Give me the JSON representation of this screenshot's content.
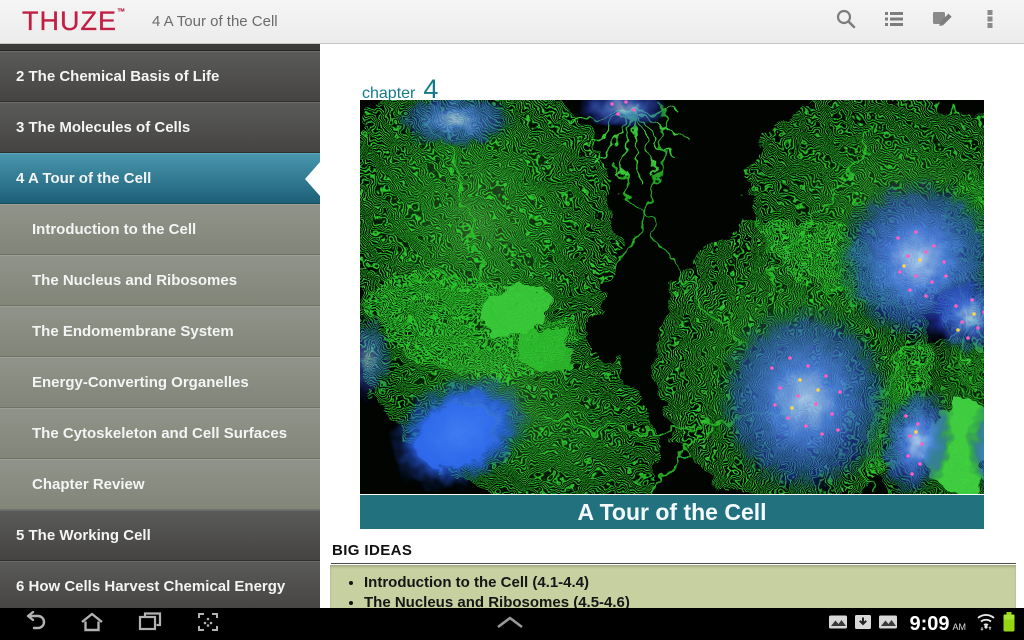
{
  "app_bar": {
    "logo": "THUZE",
    "logo_tm": "™",
    "title": "4 A Tour of the Cell",
    "actions": [
      "search",
      "table-of-contents",
      "notes",
      "more-options"
    ]
  },
  "sidebar": {
    "rows": [
      {
        "type": "chapter",
        "label": "2 The Chemical Basis of Life"
      },
      {
        "type": "chapter",
        "label": "3 The Molecules of Cells"
      },
      {
        "type": "chapter-selected",
        "label": "4 A Tour of the Cell"
      },
      {
        "type": "section",
        "label": "Introduction to the Cell"
      },
      {
        "type": "section",
        "label": "The Nucleus and Ribosomes"
      },
      {
        "type": "section",
        "label": "The Endomembrane System"
      },
      {
        "type": "section",
        "label": "Energy-Converting Organelles"
      },
      {
        "type": "section",
        "label": "The Cytoskeleton and Cell Surfaces"
      },
      {
        "type": "section",
        "label": "Chapter Review"
      },
      {
        "type": "chapter",
        "label": "5 The Working Cell"
      },
      {
        "type": "chapter",
        "label": "6 How Cells Harvest Chemical Energy"
      }
    ]
  },
  "content": {
    "chapter_label": "chapter",
    "chapter_number": "4",
    "figure_description": "fluorescence-micrograph-of-dividing-cells",
    "banner_title": "A Tour of the Cell",
    "big_ideas_heading": "BIG IDEAS",
    "big_ideas": [
      "Introduction to the Cell (4.1-4.4)",
      "The Nucleus and Ribosomes (4.5-4.6)"
    ]
  },
  "nav_bar": {
    "left_buttons": [
      "back",
      "home",
      "recent-apps",
      "screenshot"
    ],
    "center": "expand-handle",
    "notification_icons": [
      "gallery",
      "download",
      "gallery"
    ],
    "status_icons": [
      "wifi",
      "battery"
    ]
  },
  "status_bar": {
    "time": "9:09",
    "meridiem": "AM"
  },
  "colors": {
    "accent_teal": "#21717f",
    "sidebar_selected_teal": "#2a7f99",
    "logo_crimson": "#c12045",
    "ideas_box_green": "#c6d0a0",
    "battery_green": "#95d611"
  }
}
